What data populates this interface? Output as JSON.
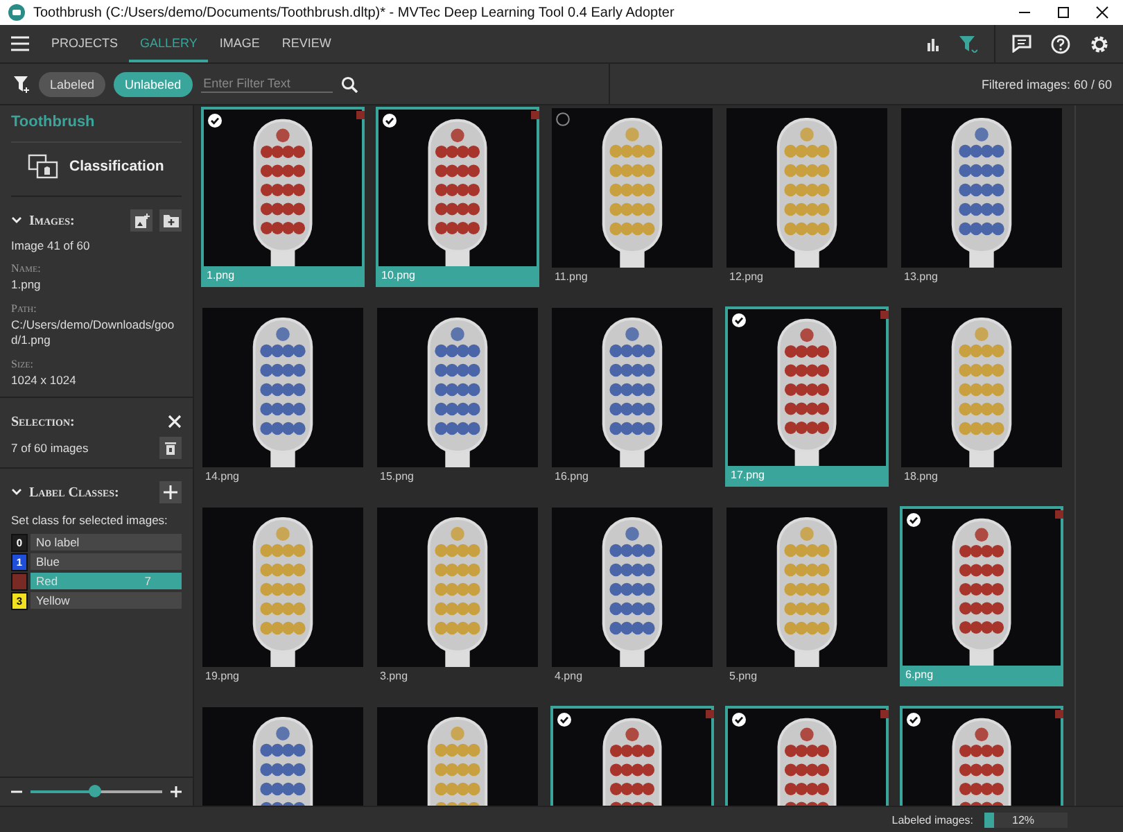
{
  "window": {
    "title": "Toothbrush (C:/Users/demo/Documents/Toothbrush.dltp)* - MVTec Deep Learning Tool 0.4 Early Adopter"
  },
  "nav": {
    "tabs": [
      {
        "label": "PROJECTS",
        "selected": false
      },
      {
        "label": "GALLERY",
        "selected": true
      },
      {
        "label": "IMAGE",
        "selected": false
      },
      {
        "label": "REVIEW",
        "selected": false
      }
    ],
    "filter_active": true
  },
  "filter_bar": {
    "chips": [
      {
        "label": "Labeled",
        "selected": false
      },
      {
        "label": "Unlabeled",
        "selected": true
      }
    ],
    "search": {
      "placeholder": "Enter Filter Text"
    },
    "count": "Filtered images: 60 / 60"
  },
  "sidebar": {
    "project": "Toothbrush",
    "method": "Classification",
    "images": {
      "heading": "Images:",
      "expanded": true,
      "position": "Image 41 of 60",
      "fields": [
        {
          "label": "Name:",
          "value": "1.png"
        },
        {
          "label": "Path:",
          "value": "C:/Users/demo/Downloads/good/1.png"
        },
        {
          "label": "Size:",
          "value": "1024 x 1024"
        }
      ]
    },
    "selection": {
      "heading": "Selection:",
      "count": "7 of 60 images"
    },
    "label_classes": {
      "heading": "Label Classes:",
      "expanded": true,
      "hint": "Set class for selected images:",
      "classes": [
        {
          "index": "0",
          "name": "No label",
          "color": "#1e1e1e",
          "selected": false
        },
        {
          "index": "1",
          "name": "Blue",
          "color": "#1f4fd8",
          "selected": false
        },
        {
          "name": "Red",
          "color": "#7a2a24",
          "selected": true,
          "count": "7"
        },
        {
          "index": "3",
          "name": "Yellow",
          "color": "#f0e020",
          "selected": false
        }
      ]
    },
    "zoom": {
      "level": 0.49
    }
  },
  "gallery": {
    "images": [
      {
        "name": "1.png",
        "color": "#a8352c",
        "selected": true,
        "labeled": true,
        "hovered": false
      },
      {
        "name": "10.png",
        "color": "#a8352c",
        "selected": true,
        "labeled": true,
        "hovered": false
      },
      {
        "name": "11.png",
        "color": "#c9a040",
        "selected": false,
        "labeled": false,
        "hovered": true
      },
      {
        "name": "12.png",
        "color": "#c9a040",
        "selected": false,
        "labeled": false,
        "hovered": false
      },
      {
        "name": "13.png",
        "color": "#4a66a8",
        "selected": false,
        "labeled": false,
        "hovered": false
      },
      {
        "name": "14.png",
        "color": "#4a66a8",
        "selected": false,
        "labeled": false,
        "hovered": false
      },
      {
        "name": "15.png",
        "color": "#4a66a8",
        "selected": false,
        "labeled": false,
        "hovered": false
      },
      {
        "name": "16.png",
        "color": "#4a66a8",
        "selected": false,
        "labeled": false,
        "hovered": false
      },
      {
        "name": "17.png",
        "color": "#a8352c",
        "selected": true,
        "labeled": true,
        "hovered": false
      },
      {
        "name": "18.png",
        "color": "#c9a040",
        "selected": false,
        "labeled": false,
        "hovered": false
      },
      {
        "name": "19.png",
        "color": "#c9a040",
        "selected": false,
        "labeled": false,
        "hovered": false
      },
      {
        "name": "3.png",
        "color": "#c9a040",
        "selected": false,
        "labeled": false,
        "hovered": false
      },
      {
        "name": "4.png",
        "color": "#4a66a8",
        "selected": false,
        "labeled": false,
        "hovered": false
      },
      {
        "name": "5.png",
        "color": "#c9a040",
        "selected": false,
        "labeled": false,
        "hovered": false
      },
      {
        "name": "6.png",
        "color": "#a8352c",
        "selected": true,
        "labeled": true,
        "hovered": false
      },
      {
        "color": "#4a66a8",
        "selected": false,
        "labeled": false,
        "hovered": false
      },
      {
        "color": "#c9a040",
        "selected": false,
        "labeled": false,
        "hovered": false
      },
      {
        "color": "#a8352c",
        "selected": true,
        "labeled": true,
        "hovered": false
      },
      {
        "color": "#a8352c",
        "selected": true,
        "labeled": true,
        "hovered": false
      },
      {
        "color": "#a8352c",
        "selected": true,
        "labeled": true,
        "hovered": false
      }
    ]
  },
  "status_bar": {
    "label": "Labeled images:",
    "level": 0.12,
    "reading": "12%"
  }
}
